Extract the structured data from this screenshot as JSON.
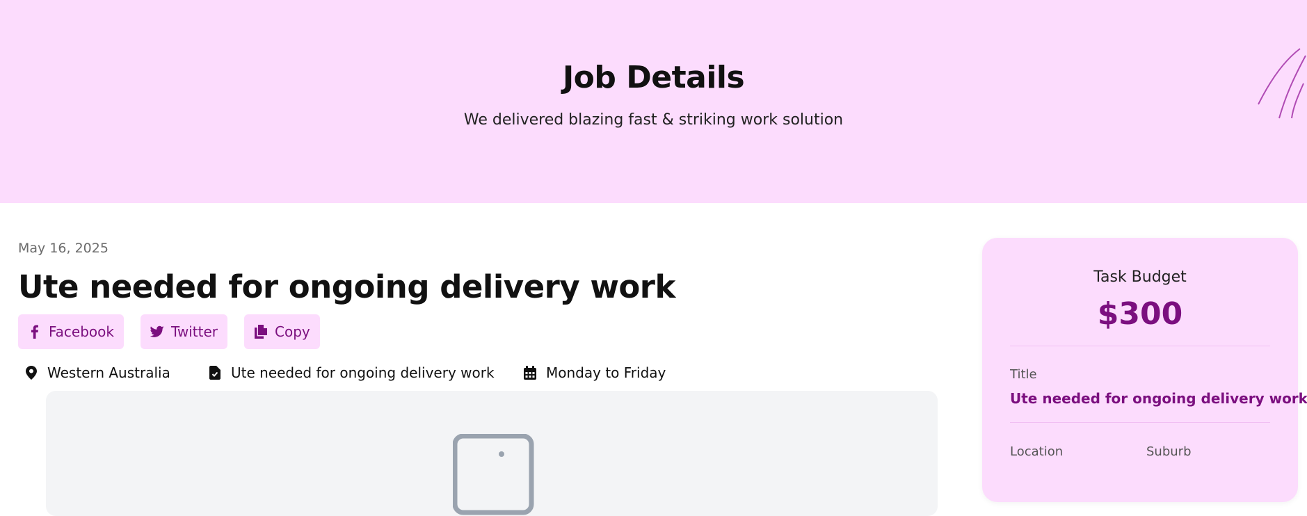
{
  "hero": {
    "title": "Job Details",
    "subtitle": "We delivered blazing fast & striking work solution"
  },
  "job": {
    "date": "May 16, 2025",
    "title": "Ute needed for ongoing delivery work",
    "share": [
      {
        "label": "Facebook",
        "icon": "facebook-icon"
      },
      {
        "label": "Twitter",
        "icon": "twitter-icon"
      },
      {
        "label": "Copy",
        "icon": "copy-icon"
      }
    ],
    "meta": {
      "location": "Western Australia",
      "category": "Ute needed for ongoing delivery work",
      "schedule": "Monday to Friday"
    }
  },
  "sidebar": {
    "budget_label": "Task Budget",
    "budget_value": "$300",
    "title_label": "Title",
    "title_value": "Ute needed for ongoing delivery work",
    "location_label": "Location",
    "suburb_label": "Suburb"
  },
  "colors": {
    "accent": "#7b0f7f",
    "hero_bg": "#fcdcfd",
    "card_bg": "#fcdcfd",
    "placeholder_bg": "#f3f4f6"
  }
}
